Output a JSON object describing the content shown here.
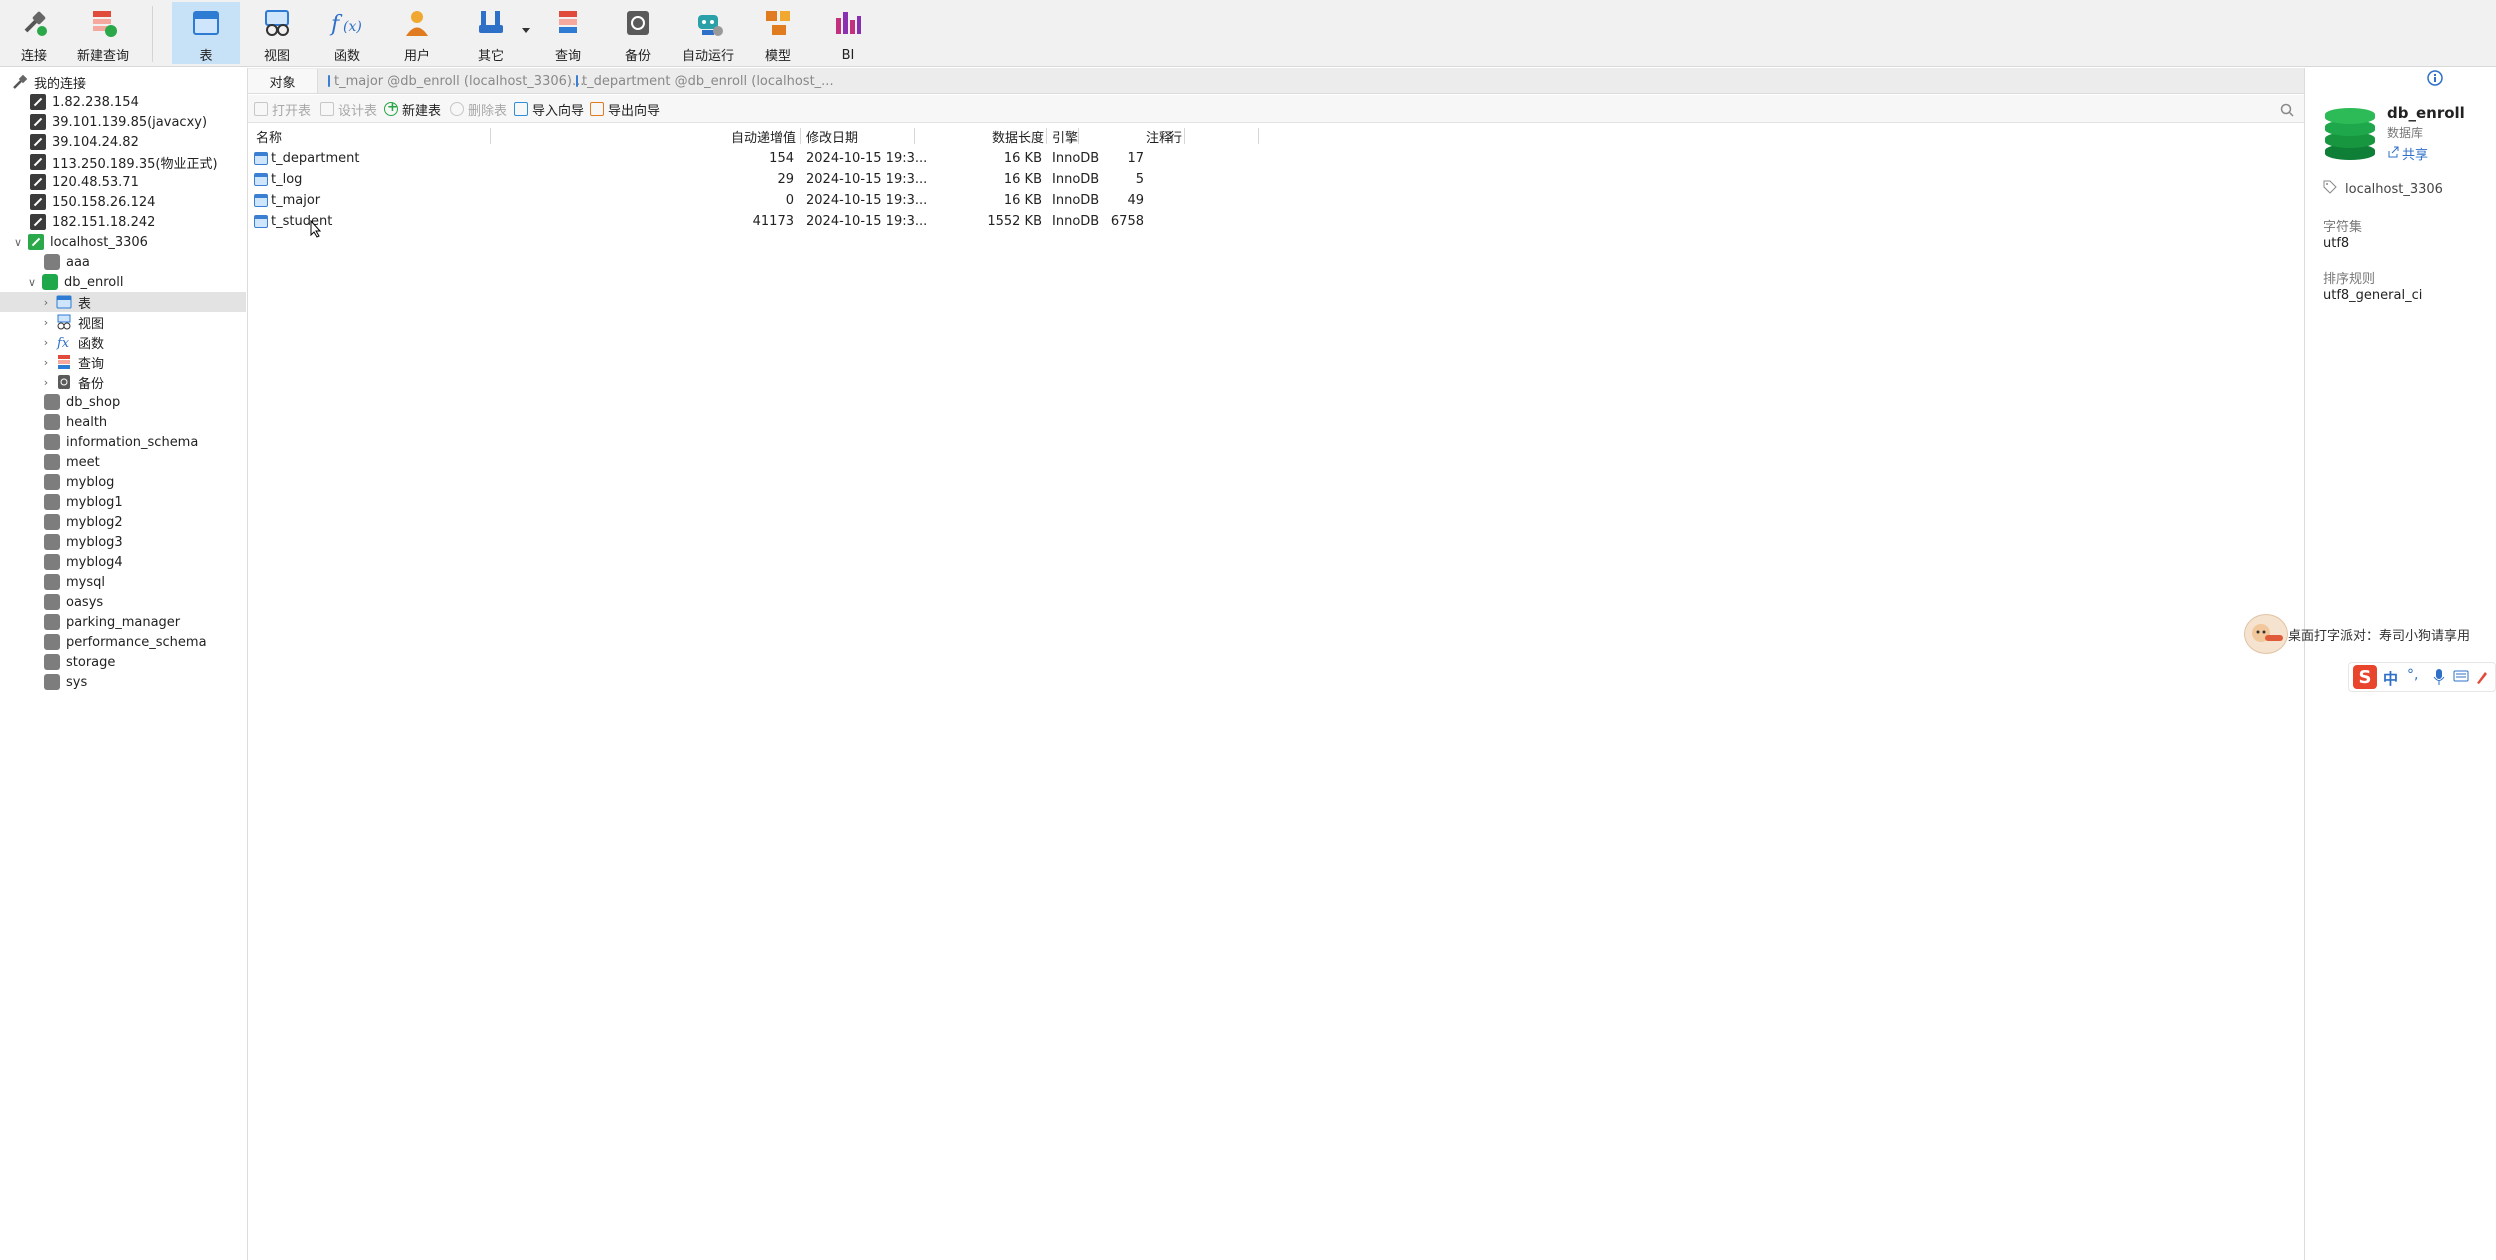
{
  "toolbar": {
    "items": [
      {
        "label": "连接",
        "icon": "plug-icon"
      },
      {
        "label": "新建查询",
        "icon": "new-query-icon"
      },
      {
        "label": "表",
        "icon": "table-icon",
        "active": true
      },
      {
        "label": "视图",
        "icon": "view-icon"
      },
      {
        "label": "函数",
        "icon": "function-icon"
      },
      {
        "label": "用户",
        "icon": "user-icon"
      },
      {
        "label": "其它",
        "icon": "tools-icon"
      },
      {
        "label": "查询",
        "icon": "query-icon"
      },
      {
        "label": "备份",
        "icon": "backup-icon"
      },
      {
        "label": "自动运行",
        "icon": "robot-icon"
      },
      {
        "label": "模型",
        "icon": "model-icon"
      },
      {
        "label": "BI",
        "icon": "bi-icon"
      }
    ]
  },
  "tree": {
    "root_label": "我的连接",
    "connections": [
      "1.82.238.154",
      "39.101.139.85(javacxy)",
      "39.104.24.82",
      "113.250.189.35(物业正式)",
      "120.48.53.71",
      "150.158.26.124",
      "182.151.18.242"
    ],
    "active_connection": "localhost_3306",
    "databases_before": [
      "aaa"
    ],
    "active_db": "db_enroll",
    "db_children": [
      "表",
      "视图",
      "函数",
      "查询",
      "备份"
    ],
    "databases_after": [
      "db_shop",
      "health",
      "information_schema",
      "meet",
      "myblog",
      "myblog1",
      "myblog2",
      "myblog3",
      "myblog4",
      "mysql",
      "oasys",
      "parking_manager",
      "performance_schema",
      "storage",
      "sys"
    ]
  },
  "tabs": {
    "objects": "对象",
    "tab1": "t_major @db_enroll (localhost_3306)...",
    "tab2": "t_department @db_enroll (localhost_..."
  },
  "objbar": {
    "open": "打开表",
    "design": "设计表",
    "new": "新建表",
    "delete": "删除表",
    "import": "导入向导",
    "export": "导出向导"
  },
  "table": {
    "headers": {
      "name": "名称",
      "auto_inc": "自动递增值",
      "modified": "修改日期",
      "data_len": "数据长度",
      "engine": "引擎",
      "rows": "行",
      "comment": "注释"
    },
    "rows": [
      {
        "name": "t_department",
        "auto_inc": "154",
        "modified": "2024-10-15 19:3...",
        "data_len": "16 KB",
        "engine": "InnoDB",
        "rows": "17"
      },
      {
        "name": "t_log",
        "auto_inc": "29",
        "modified": "2024-10-15 19:3...",
        "data_len": "16 KB",
        "engine": "InnoDB",
        "rows": "5"
      },
      {
        "name": "t_major",
        "auto_inc": "0",
        "modified": "2024-10-15 19:3...",
        "data_len": "16 KB",
        "engine": "InnoDB",
        "rows": "49"
      },
      {
        "name": "t_student",
        "auto_inc": "41173",
        "modified": "2024-10-15 19:3...",
        "data_len": "1552 KB",
        "engine": "InnoDB",
        "rows": "6758"
      }
    ]
  },
  "rpanel": {
    "db_name": "db_enroll",
    "db_type": "数据库",
    "share": "共享",
    "connection": "localhost_3306",
    "charset_label": "字符集",
    "charset": "utf8",
    "collation_label": "排序规则",
    "collation": "utf8_general_ci"
  },
  "ime": {
    "notice": "桌面打字派对：寿司小狗请享用",
    "lang": "中"
  },
  "colors": {
    "active_tab": "#c7e1f6",
    "db_green": "#1fa84b",
    "selection": "#e3e3e3"
  }
}
